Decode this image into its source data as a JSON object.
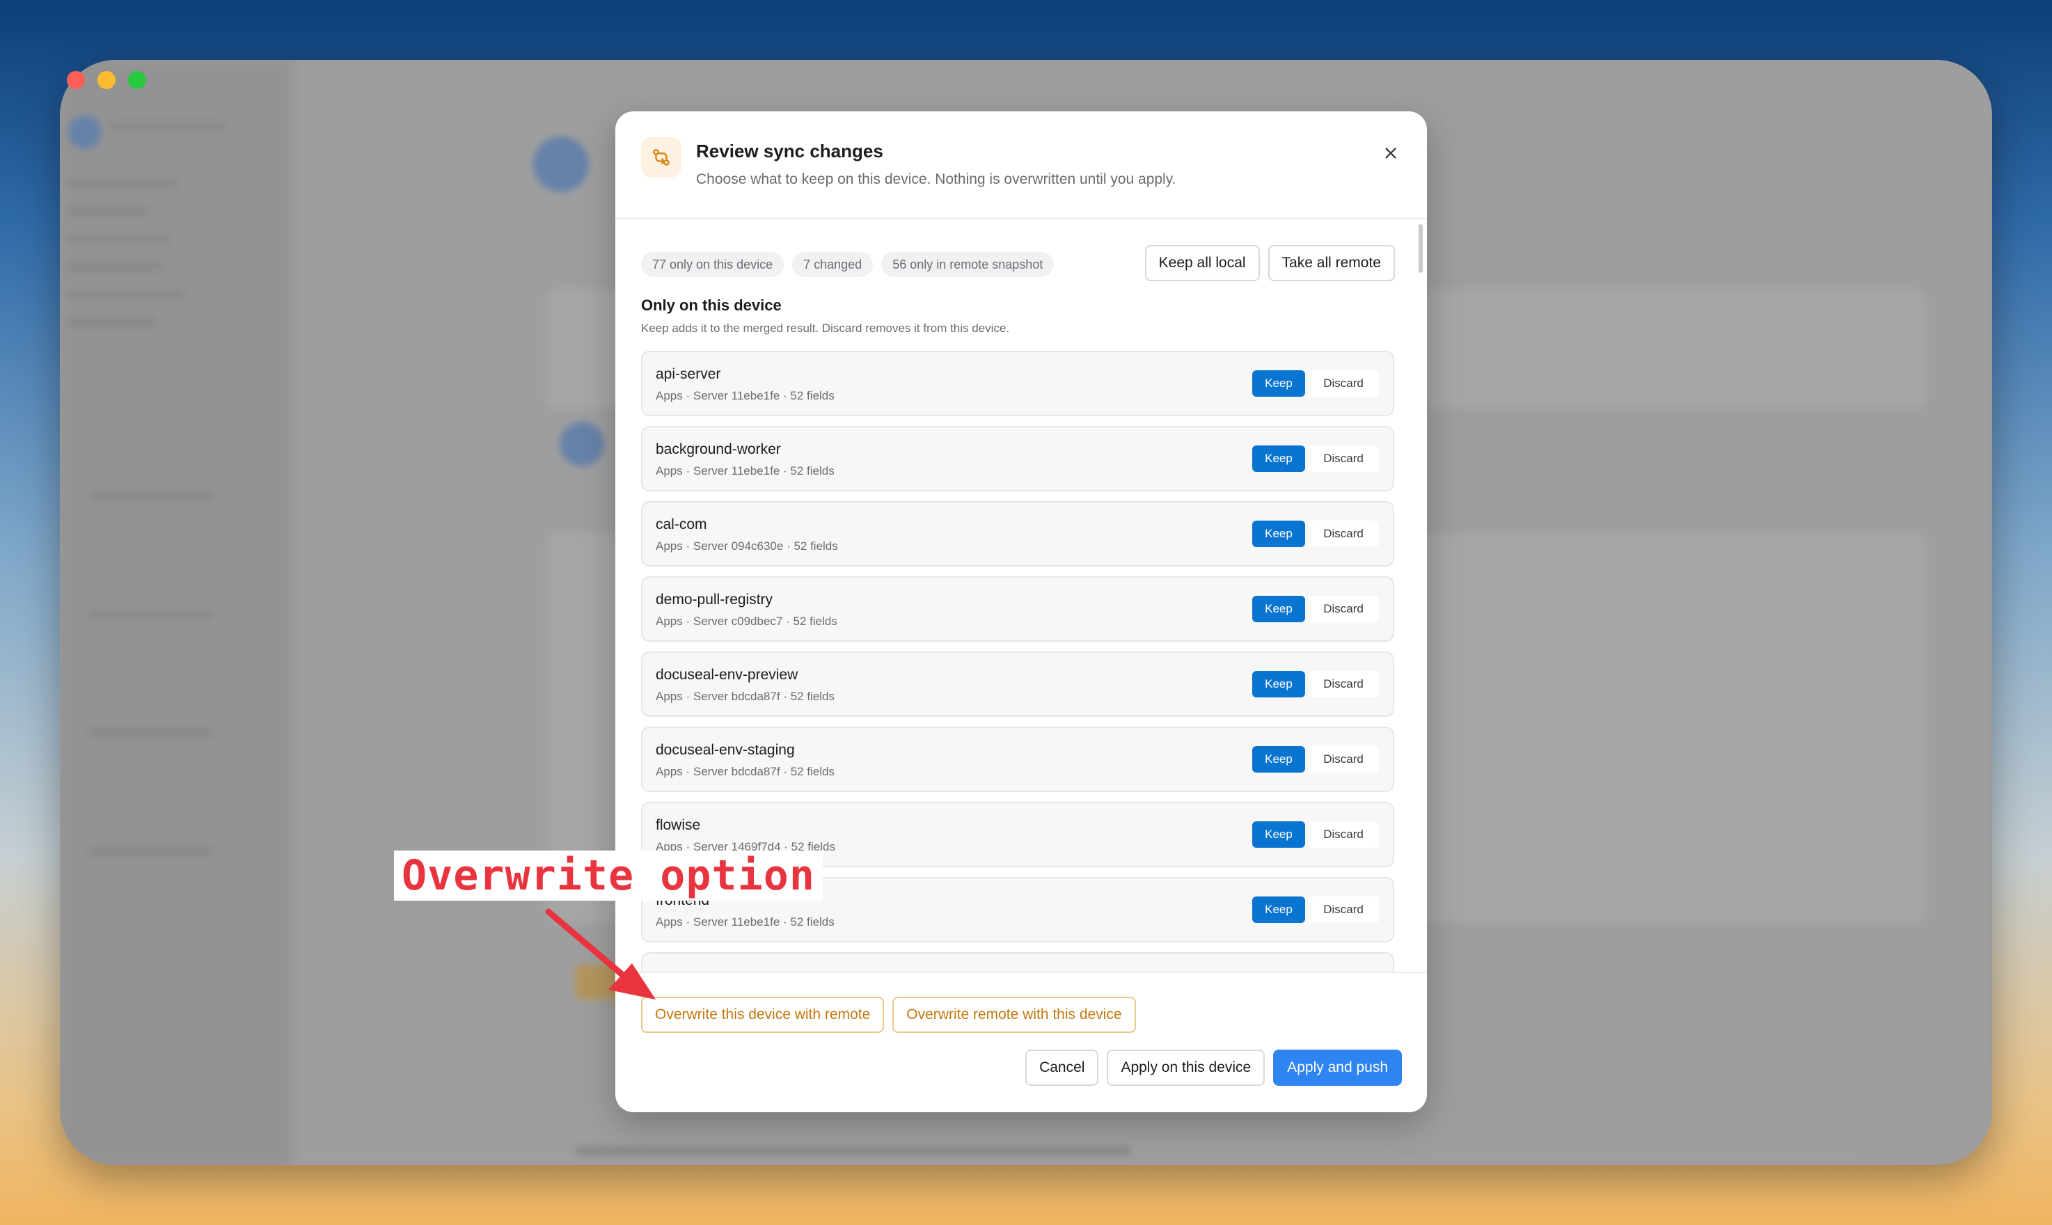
{
  "dialog": {
    "title": "Review sync changes",
    "subtitle": "Choose what to keep on this device. Nothing is overwritten until you apply.",
    "icon": "git-compare-icon",
    "close_icon": "close-icon"
  },
  "summary": {
    "chips": [
      "77 only on this device",
      "7 changed",
      "56 only in remote snapshot"
    ],
    "keep_all_local": "Keep all local",
    "take_all_remote": "Take all remote"
  },
  "section": {
    "title": "Only on this device",
    "description": "Keep adds it to the merged result. Discard removes it from this device."
  },
  "items": [
    {
      "name": "api-server",
      "meta": "Apps · Server 11ebe1fe · 52 fields"
    },
    {
      "name": "background-worker",
      "meta": "Apps · Server 11ebe1fe · 52 fields"
    },
    {
      "name": "cal-com",
      "meta": "Apps · Server 094c630e · 52 fields"
    },
    {
      "name": "demo-pull-registry",
      "meta": "Apps · Server c09dbec7 · 52 fields"
    },
    {
      "name": "docuseal-env-preview",
      "meta": "Apps · Server bdcda87f · 52 fields"
    },
    {
      "name": "docuseal-env-staging",
      "meta": "Apps · Server bdcda87f · 52 fields"
    },
    {
      "name": "flowise",
      "meta": "Apps · Server 1469f7d4 · 52 fields"
    },
    {
      "name": "frontend",
      "meta": "Apps · Server 11ebe1fe · 52 fields"
    },
    {
      "name": "",
      "meta": ""
    }
  ],
  "row_actions": {
    "keep": "Keep",
    "discard": "Discard"
  },
  "footer": {
    "overwrite_device": "Overwrite this device with remote",
    "overwrite_remote": "Overwrite remote with this device",
    "cancel": "Cancel",
    "apply_device": "Apply on this device",
    "apply_push": "Apply and push"
  },
  "annotation": {
    "text": "Overwrite option"
  },
  "colors": {
    "keep_button": "#0a74d1",
    "primary_button": "#2e84f0",
    "overwrite_text": "#c4770e",
    "annotation": "#e8343f"
  }
}
